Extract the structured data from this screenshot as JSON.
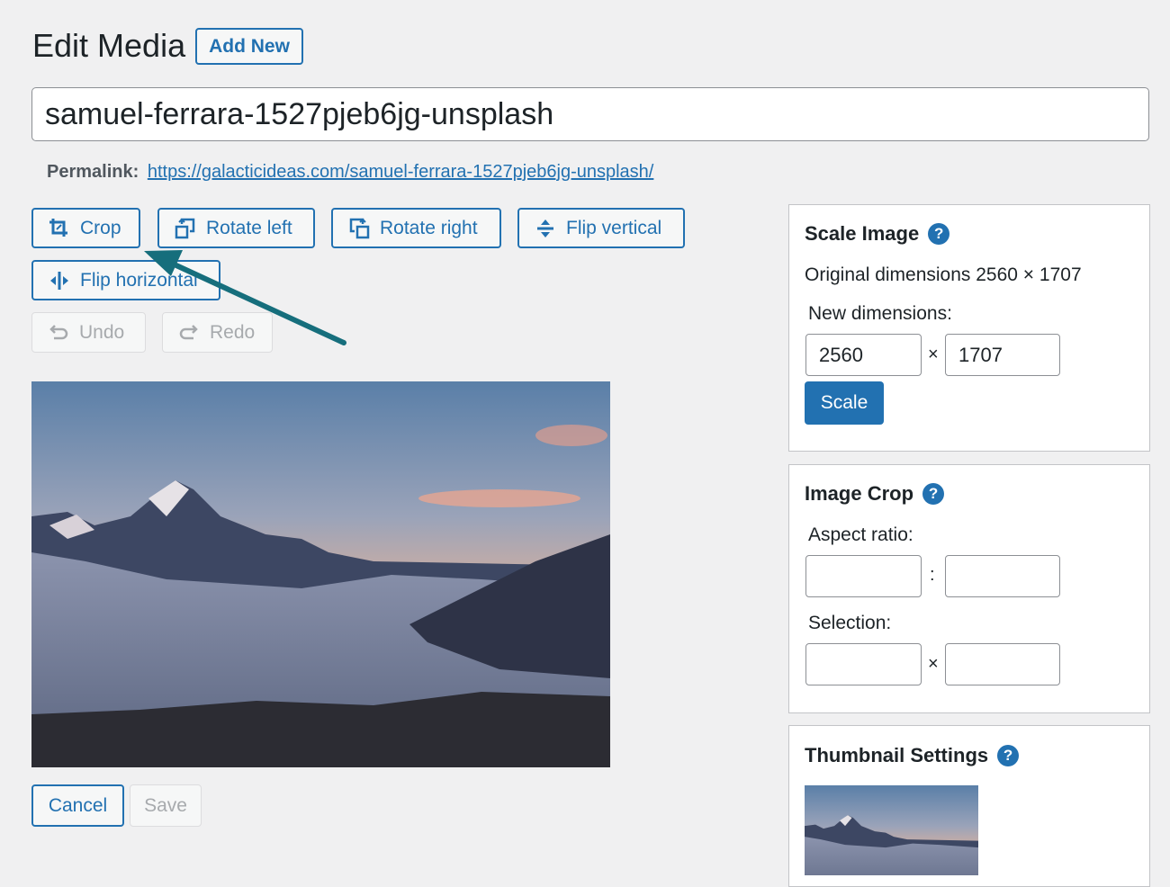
{
  "header": {
    "title": "Edit Media",
    "add_new_label": "Add New"
  },
  "post_title": {
    "value": "samuel-ferrara-1527pjeb6jg-unsplash"
  },
  "permalink": {
    "label": "Permalink:",
    "url": "https://galacticideas.com/samuel-ferrara-1527pjeb6jg-unsplash/"
  },
  "toolbar": {
    "crop": "Crop",
    "rotate_left": "Rotate left",
    "rotate_right": "Rotate right",
    "flip_vertical": "Flip vertical",
    "flip_horizontal": "Flip horizontal",
    "undo": "Undo",
    "redo": "Redo"
  },
  "actions": {
    "cancel": "Cancel",
    "save": "Save"
  },
  "scale_image": {
    "title": "Scale Image",
    "help": "?",
    "original_dimensions": "Original dimensions 2560 × 1707",
    "new_dimensions_label": "New dimensions:",
    "width": "2560",
    "separator": "×",
    "height": "1707",
    "scale_button": "Scale"
  },
  "image_crop": {
    "title": "Image Crop",
    "help": "?",
    "aspect_ratio_label": "Aspect ratio:",
    "ratio_separator": ":",
    "selection_label": "Selection:",
    "selection_separator": "×"
  },
  "thumbnail_settings": {
    "title": "Thumbnail Settings",
    "help": "?"
  },
  "colors": {
    "accent": "#2271b1",
    "annotation_arrow": "#166e7c"
  }
}
